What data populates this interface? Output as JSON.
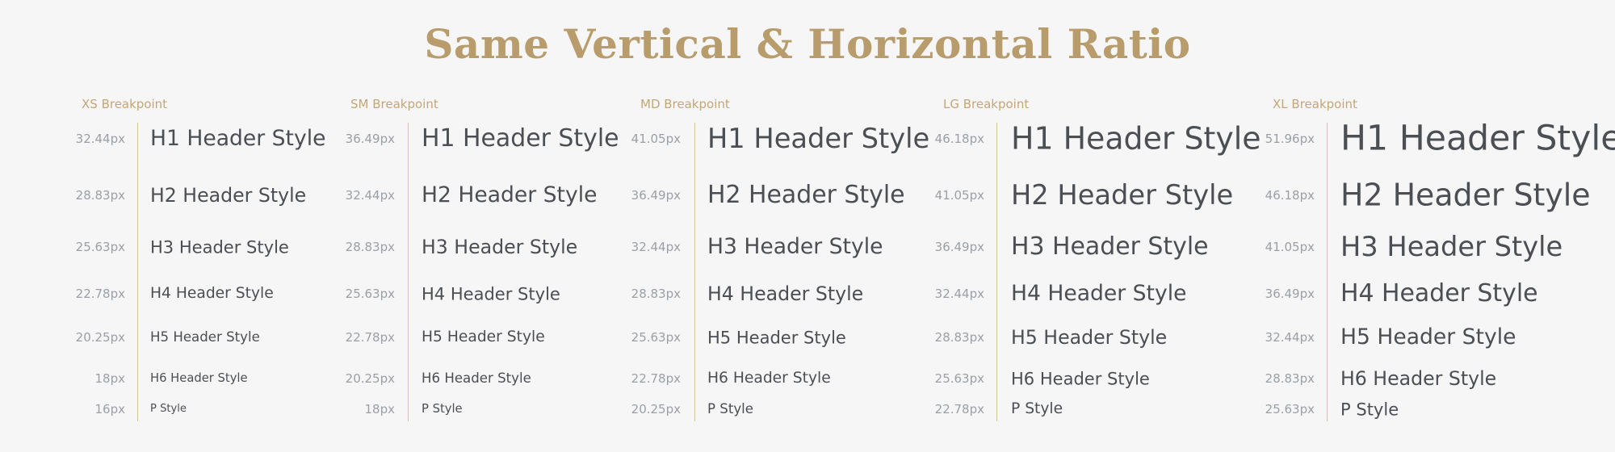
{
  "title": "Same Vertical & Horizontal Ratio",
  "styles": [
    "H1 Header Style",
    "H2 Header Style",
    "H3 Header Style",
    "H4 Header Style",
    "H5 Header Style",
    "H6 Header Style",
    "P Style"
  ],
  "breakpoints": [
    {
      "label": "XS Breakpoint",
      "sizes": [
        "32.44px",
        "28.83px",
        "25.63px",
        "22.78px",
        "20.25px",
        "18px",
        "16px"
      ]
    },
    {
      "label": "SM Breakpoint",
      "sizes": [
        "36.49px",
        "32.44px",
        "28.83px",
        "25.63px",
        "22.78px",
        "20.25px",
        "18px"
      ]
    },
    {
      "label": "MD Breakpoint",
      "sizes": [
        "41.05px",
        "36.49px",
        "32.44px",
        "28.83px",
        "25.63px",
        "22.78px",
        "20.25px"
      ]
    },
    {
      "label": "LG Breakpoint",
      "sizes": [
        "46.18px",
        "41.05px",
        "36.49px",
        "32.44px",
        "28.83px",
        "25.63px",
        "22.78px"
      ]
    },
    {
      "label": "XL Breakpoint",
      "sizes": [
        "51.96px",
        "46.18px",
        "41.05px",
        "36.49px",
        "32.44px",
        "28.83px",
        "25.63px"
      ]
    }
  ]
}
